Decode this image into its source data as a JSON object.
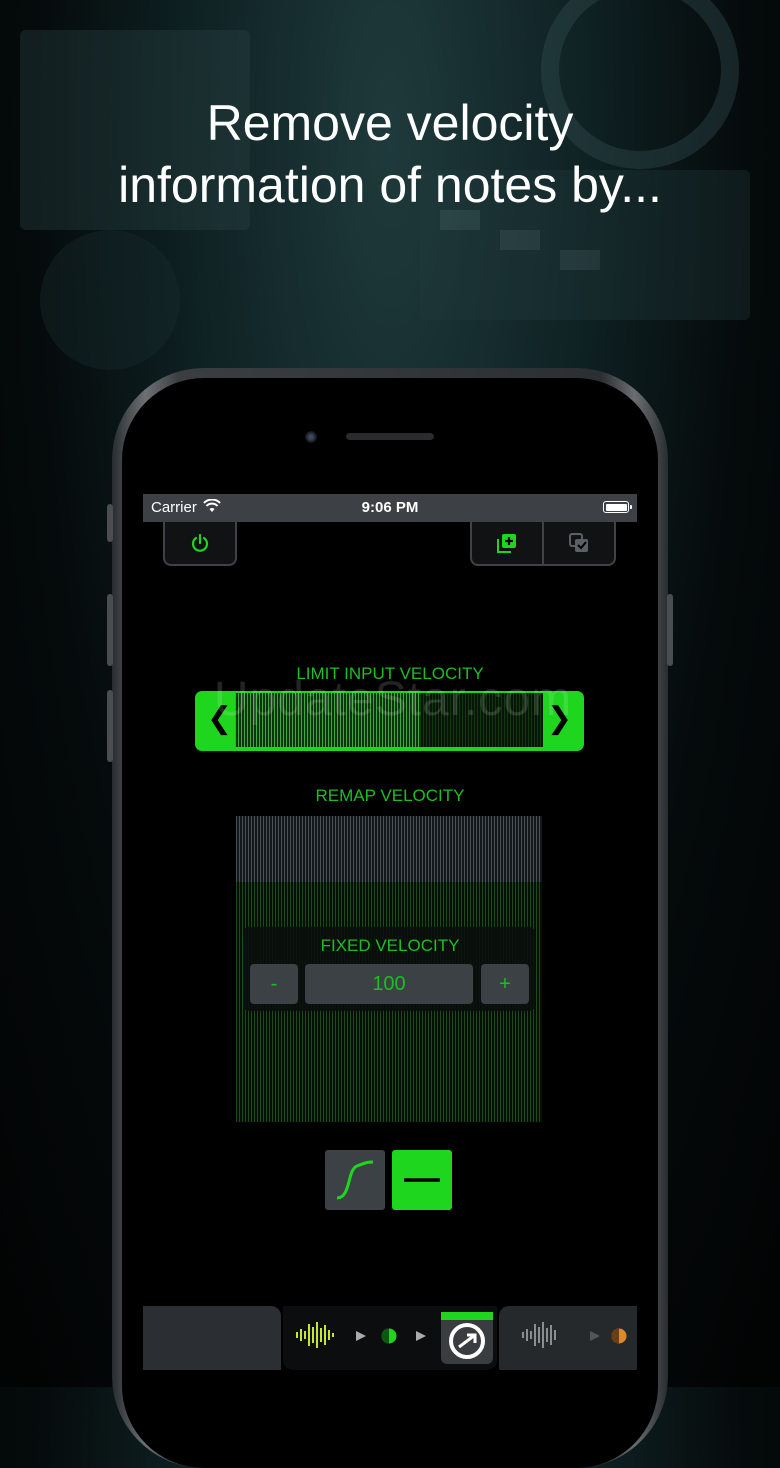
{
  "promo": {
    "headline": "Remove velocity information of notes by..."
  },
  "statusbar": {
    "carrier": "Carrier",
    "time": "9:06 PM"
  },
  "toolbar": {
    "power_icon": "power-icon",
    "add_icon": "add-preset-icon",
    "select_icon": "select-copy-icon"
  },
  "limit": {
    "label": "LIMIT INPUT VELOCITY",
    "left_arrow": "❮",
    "right_arrow": "❯",
    "level": 0.6
  },
  "watermark": {
    "text": "UpdateStar.com"
  },
  "remap": {
    "label": "REMAP VELOCITY"
  },
  "fixed": {
    "label": "FIXED VELOCITY",
    "minus": "-",
    "value": "100",
    "plus": "+"
  },
  "curve_modes": [
    {
      "icon": "s-curve-icon",
      "active": false
    },
    {
      "icon": "flat-line-icon",
      "active": true
    }
  ],
  "colors": {
    "accent": "#1ed61e",
    "label": "#1bbf21",
    "panel": "#3c4146"
  }
}
